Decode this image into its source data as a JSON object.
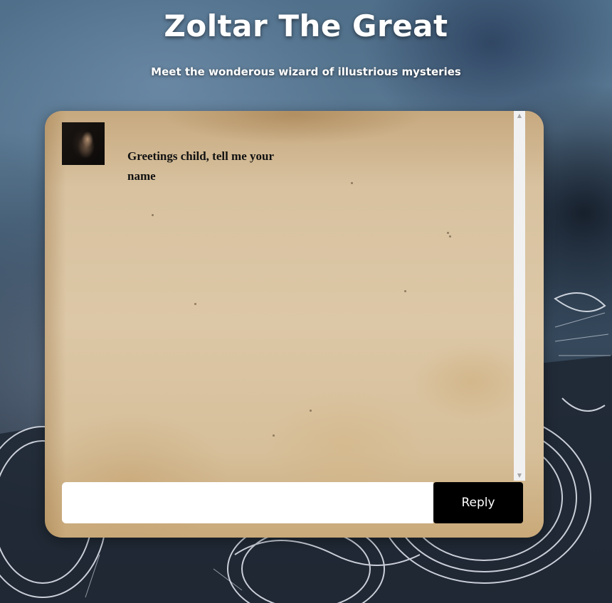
{
  "header": {
    "title": "Zoltar The Great",
    "subtitle": "Meet the wonderous wizard of illustrious mysteries"
  },
  "chat": {
    "messages": [
      {
        "sender": "Zoltar",
        "avatar_icon": "wizard-portrait",
        "text": "Greetings child, tell me your name"
      }
    ],
    "input": {
      "value": "",
      "placeholder": ""
    },
    "reply_label": "Reply"
  },
  "colors": {
    "title_text": "#ffffff",
    "reply_button_bg": "#000000",
    "reply_button_text": "#ffffff",
    "parchment": "#dcc7a6"
  }
}
